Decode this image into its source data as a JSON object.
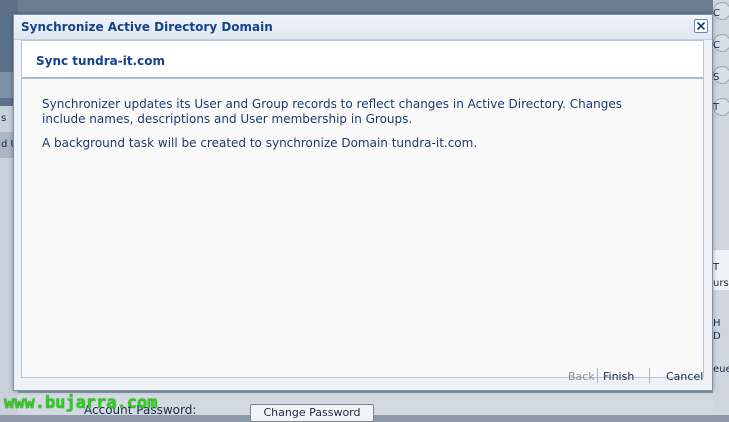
{
  "dialog": {
    "title": "Synchronize Active Directory Domain",
    "panel_title": "Sync tundra-it.com",
    "body": [
      "Synchronizer updates its User and Group records to reflect changes in Active Directory. Changes include names, descriptions and User membership in Groups.",
      "A background task will be created to synchronize Domain tundra-it.com."
    ],
    "buttons": {
      "back": "Back",
      "finish": "Finish",
      "cancel": "Cancel"
    }
  },
  "background": {
    "left_items": [
      "s",
      "d U"
    ],
    "right_items": [
      "C",
      "C",
      "S",
      "T",
      "T",
      "urs",
      "H",
      "D",
      "eue"
    ],
    "field_label": "Account Password:",
    "field_button": "Change Password"
  },
  "watermark": "www.bujarra.com",
  "colors": {
    "title_text": "#15428b",
    "body_text": "#1e3a6e",
    "watermark": "#2bd11d"
  }
}
